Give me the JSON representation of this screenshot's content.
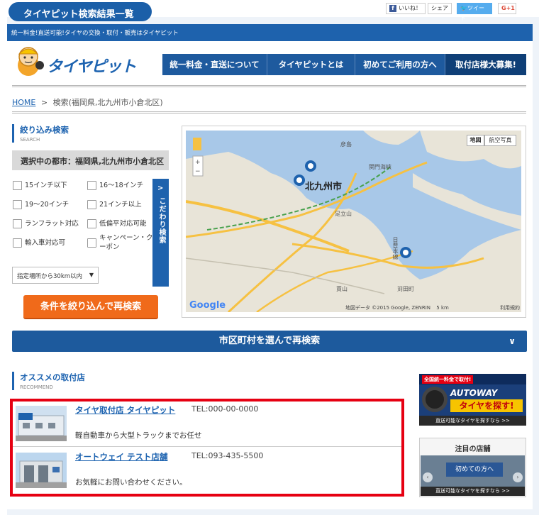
{
  "page_tag": "タイヤピット検索結果一覧",
  "topbar": {
    "tagline": "統一料金!直送可能!タイヤの交換・取付・販売はタイヤピット",
    "like": "いいね！",
    "share": "シェア",
    "tweet": "ツイート",
    "gplus": "G+1"
  },
  "logo": {
    "text": "タイヤピット"
  },
  "gnav": [
    "統一料金・直送について",
    "タイヤピットとは",
    "初めてご利用の方へ",
    "取付店様大募集!"
  ],
  "breadcrumb": {
    "home": "HOME",
    "sep": ">",
    "current": "検索(福岡県,北九州市小倉北区)"
  },
  "filter": {
    "title": "絞り込み検索",
    "subtitle": "SEARCH",
    "selected_city": "選択中の都市：福岡県,北九州市小倉北区",
    "options": [
      "15インチ以下",
      "16〜18インチ",
      "19〜20インチ",
      "21インチ以上",
      "ランフラット対応",
      "低偏平対応可能",
      "輸入車対応可",
      "キャンペーン・クーポン"
    ],
    "kodawari": "こだわり検索",
    "distance": "指定場所から30km以内",
    "search_button": "条件を絞り込んで再検索"
  },
  "map": {
    "btn_map": "地図",
    "btn_satellite": "航空写真",
    "city": "北九州市",
    "labels": [
      "彦島",
      "足立山",
      "日豊本線",
      "苅田町",
      "貫山",
      "関門海峡"
    ],
    "google": "Google",
    "copyright": "地図データ ©2015 Google, ZENRIN",
    "scale": "5 km",
    "terms": "利用規約"
  },
  "city_search_button": "市区町村を選んで再検索",
  "recommend": {
    "title": "オススメの取付店",
    "subtitle": "RECOMMEND",
    "shops": [
      {
        "name": "タイヤ取付店 タイヤピット",
        "tel": "TEL:000-00-0000",
        "desc": "軽自動車から大型トラックまでお任せ"
      },
      {
        "name": "オートウェイ テスト店舗",
        "tel": "TEL:093-435-5500",
        "desc": "お気軽にお問い合わせください。"
      }
    ]
  },
  "banner": {
    "badge": "全国統一料金で取付!",
    "brand": "AUTOWAY",
    "catch": "タイヤを探す!",
    "footer": "直送可能なタイヤを探すなら >>"
  },
  "featured": {
    "title": "注目の店舗",
    "caption": "初めての方へ",
    "footer": "直送可能なタイヤを探すなら >>"
  },
  "colors": {
    "brand_blue": "#1d63b0",
    "accent_orange": "#f06a1a",
    "highlight_red": "#e60012"
  }
}
